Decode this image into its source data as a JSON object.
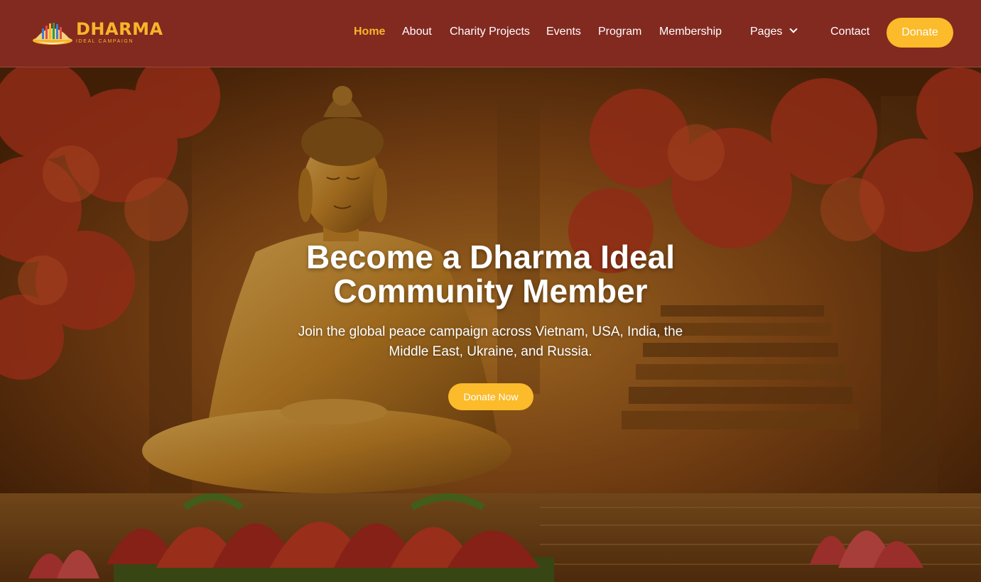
{
  "brand": {
    "title": "DHARMA",
    "subtitle": "IDEAL CAMPAIGN",
    "logo_icon": "temple-lotus-icon",
    "accent_color": "#f7b52a"
  },
  "nav": {
    "items": [
      {
        "label": "Home",
        "active": true
      },
      {
        "label": "About"
      },
      {
        "label": "Charity Projects"
      },
      {
        "label": "Events"
      },
      {
        "label": "Program"
      },
      {
        "label": "Membership"
      },
      {
        "label": "Pages",
        "has_dropdown": true
      },
      {
        "label": "Contact"
      }
    ],
    "donate_label": "Donate"
  },
  "hero": {
    "title": "Become a Dharma Ideal Community Member",
    "subtitle": "Join the global peace campaign across Vietnam, USA, India, the Middle East, Ukraine, and Russia.",
    "cta_label": "Donate Now",
    "background": "golden-buddha-statue-on-lotus"
  },
  "colors": {
    "navbar": "#822920",
    "button": "#fbbb2a"
  }
}
